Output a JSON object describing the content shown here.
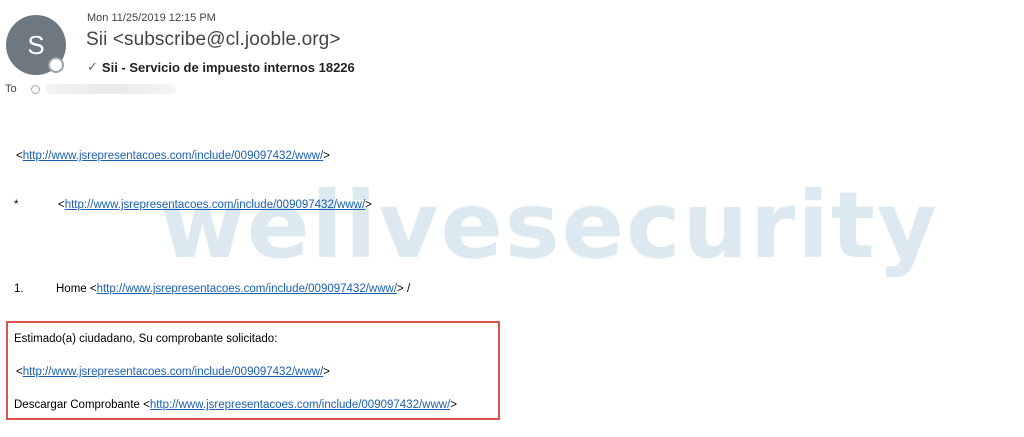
{
  "header": {
    "avatar_initial": "S",
    "date": "Mon 11/25/2019 12:15 PM",
    "sender": "Sii <subscribe@cl.jooble.org>",
    "subject": "Sii - Servicio de impuesto internos 18226",
    "to_label": "To"
  },
  "watermark": "welivesecurity",
  "body": {
    "link_url": "http://www.jsrepresentacoes.com/include/009097432/www/",
    "lt": "<",
    "gt": ">",
    "bullet": "*",
    "item_number": "1.",
    "home_label": "Home ",
    "slash": " /",
    "greeting": "Estimado(a) ciudadano, Su comprobante solicitado:",
    "download_label": "Descargar Comprobante "
  },
  "colors": {
    "link": "#1a5fb4",
    "highlight_border": "#d9534f",
    "avatar": "#6e7880",
    "watermark": "#dce9f1"
  }
}
